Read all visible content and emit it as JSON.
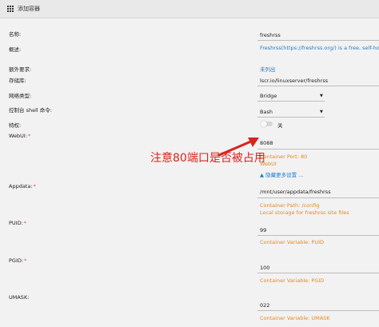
{
  "header": {
    "title": "添加容器"
  },
  "labels": {
    "name": "名称:",
    "overview": "概述:",
    "extra": "额外要求:",
    "repo": "存储库:",
    "network": "网络类型:",
    "console": "控制台 shell 命令:",
    "privileged": "特权:",
    "webui": "WebUI:",
    "appdata": "Appdata:",
    "puid": "PUID:",
    "pgid": "PGID:",
    "umask": "UMASK:",
    "required_mark": "*"
  },
  "fields": {
    "name": "freshrss",
    "overview": "Freshrss(https://freshrss.org/) is a free, self-hosted",
    "extra": "未列出",
    "repo": "lscr.io/linuxserver/freshrss",
    "network": "Bridge",
    "console": "Bash",
    "privileged_label": "关",
    "webui": "8088",
    "webui_port": "Container Port: 80",
    "webui_sub": "WebUI",
    "hide_settings": "隐藏更多设置 ...",
    "appdata": "/mnt/user/appdata/freshrss",
    "appdata_path": "Container Path: /config",
    "appdata_desc": "Local storage for freshrss site files",
    "puid": "99",
    "puid_var": "Container Variable: PUID",
    "pgid": "100",
    "pgid_var": "Container Variable: PGID",
    "umask": "022",
    "umask_var": "Container Variable: UMASK"
  },
  "annotation": "注意80端口是否被占用",
  "colors": {
    "link": "#1e7dc9",
    "hint": "#e8871e",
    "annotation": "#d9231d"
  }
}
